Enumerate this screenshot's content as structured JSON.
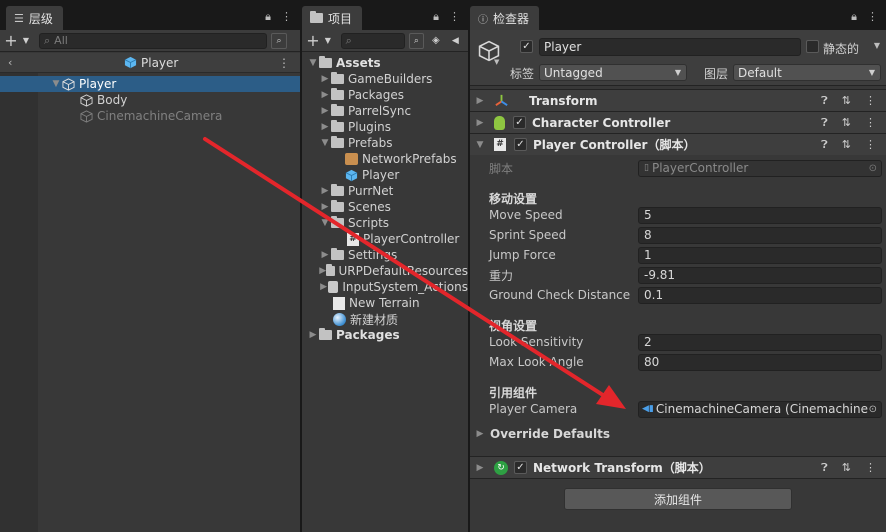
{
  "hierarchy": {
    "tab_label": "层级",
    "search_placeholder": "All",
    "scene_title": "Player",
    "items": [
      {
        "label": "Player"
      },
      {
        "label": "Body"
      },
      {
        "label": "CinemachineCamera"
      }
    ]
  },
  "project": {
    "tab_label": "项目",
    "search_placeholder": "",
    "badge_count": "",
    "items": [
      {
        "label": "Assets"
      },
      {
        "label": "GameBuilders"
      },
      {
        "label": "Packages"
      },
      {
        "label": "ParrelSync"
      },
      {
        "label": "Plugins"
      },
      {
        "label": "Prefabs"
      },
      {
        "label": "NetworkPrefabs"
      },
      {
        "label": "Player"
      },
      {
        "label": "PurrNet"
      },
      {
        "label": "Scenes"
      },
      {
        "label": "Scripts"
      },
      {
        "label": "PlayerController"
      },
      {
        "label": "Settings"
      },
      {
        "label": "URPDefaultResources"
      },
      {
        "label": "InputSystem_Actions"
      },
      {
        "label": "New Terrain"
      },
      {
        "label": "新建材质"
      },
      {
        "label": "Packages"
      }
    ]
  },
  "inspector": {
    "tab_label": "检查器",
    "object_name": "Player",
    "static_label": "静态的",
    "tag_label": "标签",
    "tag_value": "Untagged",
    "layer_label": "图层",
    "layer_value": "Default",
    "components": {
      "transform": "Transform",
      "character_controller": "Character Controller",
      "player_controller": "Player Controller（脚本）",
      "network_transform": "Network Transform（脚本）"
    },
    "script_label": "脚本",
    "script_value": "PlayerController",
    "section_move": "移动设置",
    "move_speed_label": "Move Speed",
    "move_speed": "5",
    "sprint_speed_label": "Sprint Speed",
    "sprint_speed": "8",
    "jump_force_label": "Jump Force",
    "jump_force": "1",
    "gravity_label": "重力",
    "gravity": "-9.81",
    "ground_check_label": "Ground Check Distance",
    "ground_check": "0.1",
    "section_view": "视角设置",
    "look_sensitivity_label": "Look Sensitivity",
    "look_sensitivity": "2",
    "max_look_angle_label": "Max Look Angle",
    "max_look_angle": "80",
    "section_refs": "引用组件",
    "player_camera_label": "Player Camera",
    "player_camera": "CinemachineCamera (Cinemachine C",
    "override_defaults": "Override Defaults",
    "add_component": "添加组件"
  },
  "colors": {
    "arrow": "#e3262b",
    "selection": "#2c5d87",
    "panel": "#383838"
  }
}
